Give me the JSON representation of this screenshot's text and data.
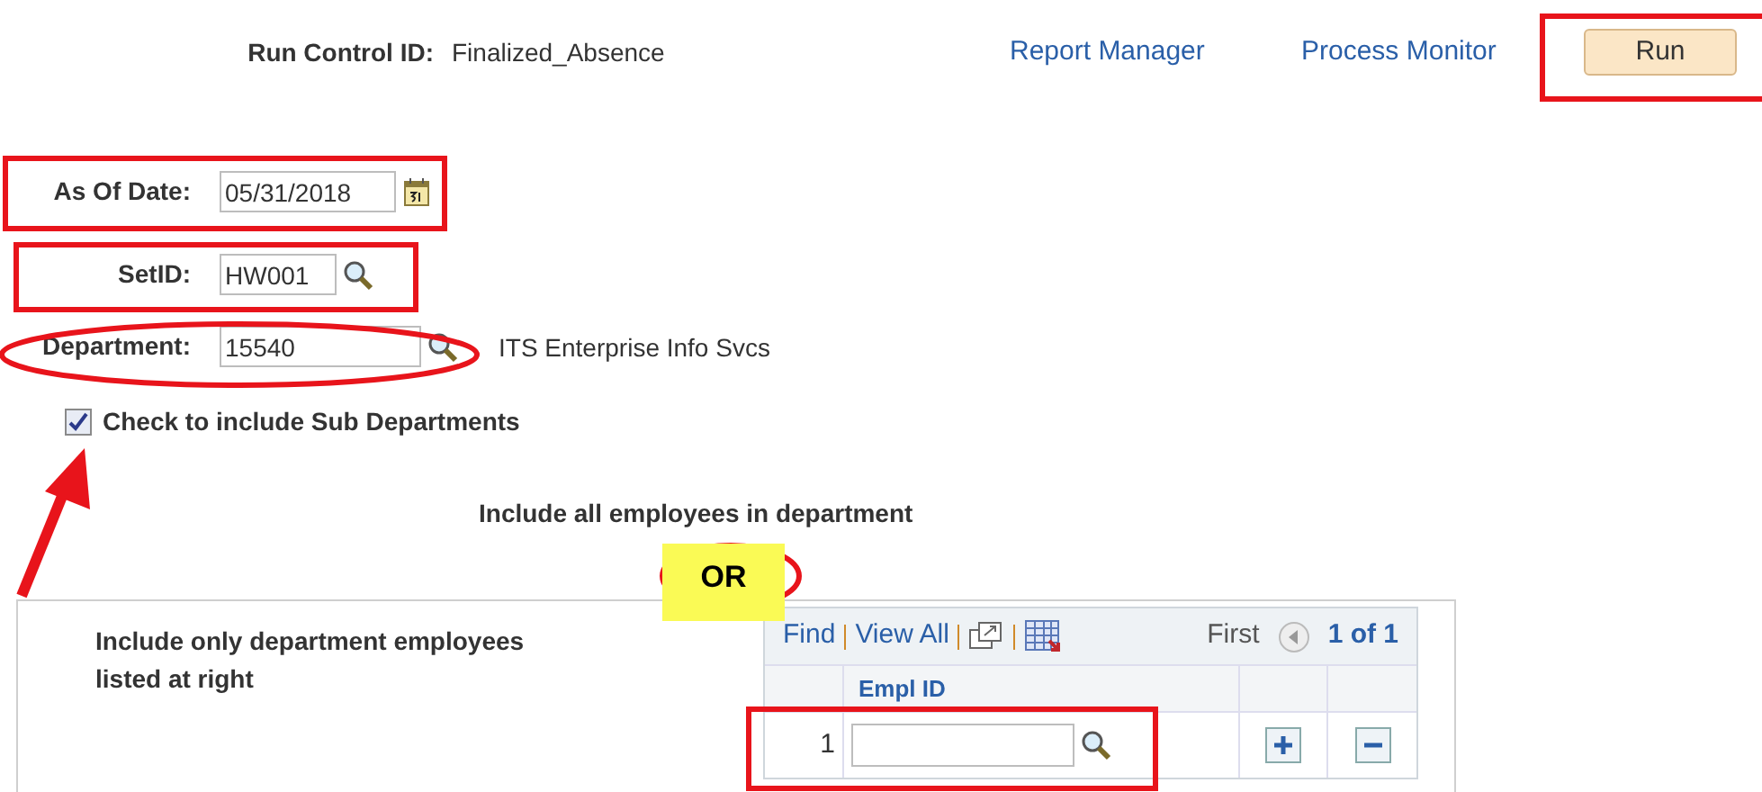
{
  "run_control": {
    "label": "Run Control ID:",
    "value": "Finalized_Absence"
  },
  "links": [
    "Report Manager",
    "Process Monitor"
  ],
  "run_button": "Run",
  "fields": [
    {
      "kind": "date",
      "label": "As Of Date:",
      "value": "05/31/2018"
    },
    {
      "kind": "lookup",
      "label": "SetID:",
      "value": "HW001"
    },
    {
      "kind": "lookup",
      "label": "Department:",
      "value": "15540",
      "description": "ITS Enterprise Info Svcs"
    }
  ],
  "sub_departments": {
    "label": "Check to include Sub Departments",
    "checked": true
  },
  "include_all": "Include all employees in department",
  "or_label": "OR",
  "include_only": "Include only department employees listed at right",
  "grid": {
    "toolbar": {
      "find": "Find",
      "view_all": "View All",
      "first": "First",
      "range": "1 of 1"
    },
    "columns": [
      "Empl ID"
    ],
    "rows": [
      {
        "row_number": "1"
      }
    ]
  }
}
